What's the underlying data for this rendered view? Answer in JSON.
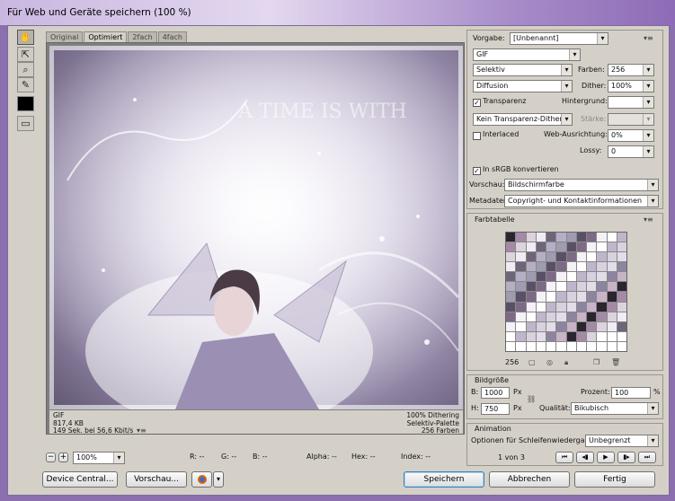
{
  "window": {
    "title": "Für Web und Geräte speichern (100 %)"
  },
  "tabs": [
    "Original",
    "Optimiert",
    "2fach",
    "4fach"
  ],
  "tools": {
    "hand": "hand-icon",
    "slice": "slice-select-icon",
    "zoom": "zoom-icon",
    "eyedropper": "eyedropper-icon",
    "color": "color-swatch",
    "preview": "preview-toggle-icon"
  },
  "image": {
    "watermark": "A TIME IS WITH"
  },
  "info_left": {
    "format": "GIF",
    "size": "817,4 KB",
    "time": "149 Sek. bei 56,6 Kbit/s"
  },
  "info_right": {
    "dither": "100% Dithering",
    "palette": "Selektiv-Palette",
    "colors": "256 Farben"
  },
  "zoom": {
    "minus": "−",
    "plus": "+",
    "value": "100%"
  },
  "readout": {
    "r": "R: --",
    "g": "G: --",
    "b": "B: --",
    "alpha": "Alpha: --",
    "hex": "Hex: --",
    "index": "Index: --"
  },
  "buttons": {
    "device_central": "Device Central...",
    "preview": "Vorschau...",
    "save": "Speichern",
    "cancel": "Abbrechen",
    "done": "Fertig"
  },
  "settings": {
    "preset_label": "Vorgabe:",
    "preset_value": "[Unbenannt]",
    "format": "GIF",
    "reduction": "Selektiv",
    "colors_label": "Farben:",
    "colors_value": "256",
    "dither_algo": "Diffusion",
    "dither_label": "Dither:",
    "dither_value": "100%",
    "transparency_label": "Transparenz",
    "transparency_checked": true,
    "matte_label": "Hintergrund:",
    "transp_dither": "Kein Transparenz-Dither",
    "amount_label": "Stärke:",
    "interlaced_label": "Interlaced",
    "interlaced_checked": false,
    "websnap_label": "Web-Ausrichtung:",
    "websnap_value": "0%",
    "lossy_label": "Lossy:",
    "lossy_value": "0",
    "srgb_label": "In sRGB konvertieren",
    "srgb_checked": true,
    "preview_label": "Vorschau:",
    "preview_value": "Bildschirmfarbe",
    "metadata_label": "Metadaten:",
    "metadata_value": "Copyright- und Kontaktinformationen"
  },
  "color_table": {
    "title": "Farbtabelle",
    "count": "256"
  },
  "image_size": {
    "title": "Bildgröße",
    "w_label": "B:",
    "w_value": "1000",
    "h_label": "H:",
    "h_value": "750",
    "unit": "Px",
    "percent_label": "Prozent:",
    "percent_value": "100",
    "percent_unit": "%",
    "quality_label": "Qualität:",
    "quality_value": "Bikubisch"
  },
  "animation": {
    "title": "Animation",
    "loop_label": "Optionen für Schleifenwiedergabe:",
    "loop_value": "Unbegrenzt",
    "frame": "1 von 3"
  },
  "colors": {
    "accent": "#3c7fb1",
    "titlebar": "#c9b7e0"
  }
}
